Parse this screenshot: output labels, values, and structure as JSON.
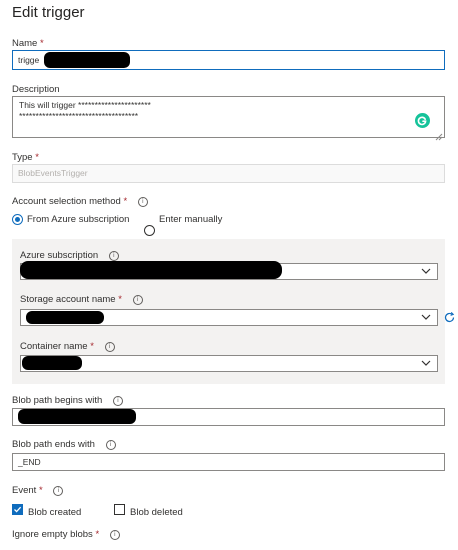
{
  "panel_title": "Edit trigger",
  "required_mark": "*",
  "name": {
    "label": "Name",
    "value": "trigge"
  },
  "description": {
    "label": "Description",
    "line1": "This will trigger **********************",
    "line2": "************************************"
  },
  "type": {
    "label": "Type",
    "value": "BlobEventsTrigger"
  },
  "account_selection": {
    "label": "Account selection method",
    "options": [
      "From Azure subscription",
      "Enter manually"
    ],
    "selected": "From Azure subscription"
  },
  "azure_subscription": {
    "label": "Azure subscription"
  },
  "storage_account": {
    "label": "Storage account name"
  },
  "container": {
    "label": "Container name"
  },
  "blob_begins": {
    "label": "Blob path begins with"
  },
  "blob_ends": {
    "label": "Blob path ends with",
    "value": "_END"
  },
  "event": {
    "label": "Event",
    "options": [
      {
        "label": "Blob created",
        "checked": true
      },
      {
        "label": "Blob deleted",
        "checked": false
      }
    ]
  },
  "ignore_empty": {
    "label": "Ignore empty blobs"
  },
  "icons": {
    "info": "info-icon",
    "chevron": "chevron-down-icon",
    "refresh": "refresh-icon",
    "grammarly": "grammarly-icon",
    "resize": "resize-handle-icon"
  },
  "colors": {
    "accent": "#0f6cbd",
    "required": "#a4262c",
    "panel_bg": "#f3f2f1",
    "grammarly": "#15c39a"
  }
}
